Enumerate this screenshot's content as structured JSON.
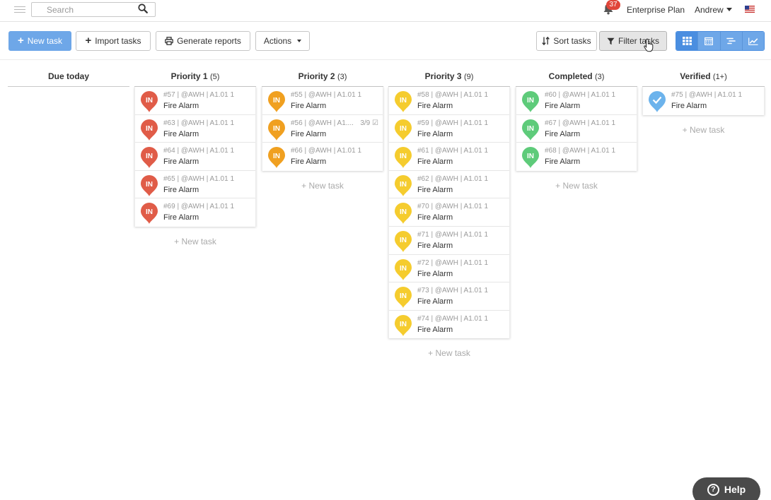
{
  "header": {
    "search_placeholder": "Search",
    "notification_count": "37",
    "plan": "Enterprise Plan",
    "user": "Andrew",
    "flag_icon": "us-flag-icon"
  },
  "toolbar": {
    "new_task": "New task",
    "import_tasks": "Import tasks",
    "generate_reports": "Generate reports",
    "actions": "Actions",
    "sort_tasks": "Sort tasks",
    "filter_tasks": "Filter tasks",
    "views": [
      "board-view-icon",
      "calendar-view-icon",
      "gantt-view-icon",
      "chart-view-icon"
    ]
  },
  "colors": {
    "primary": "#6ea7e8",
    "priority1": "#e05c48",
    "priority2": "#f0a020",
    "priority3": "#f5cc2e",
    "completed": "#5ecb7a",
    "verified": "#6cb3ec"
  },
  "board": {
    "new_task_label": "+ New task",
    "columns": [
      {
        "title": "Due today",
        "count": "",
        "status": "none",
        "cards": []
      },
      {
        "title": "Priority 1",
        "count": "(5)",
        "status": "priority1",
        "cards": [
          {
            "meta": "#57 | @AWH | A1.01 1",
            "title": "Fire Alarm",
            "pin": "IN"
          },
          {
            "meta": "#63 | @AWH | A1.01 1",
            "title": "Fire Alarm",
            "pin": "IN"
          },
          {
            "meta": "#64 | @AWH | A1.01 1",
            "title": "Fire Alarm",
            "pin": "IN"
          },
          {
            "meta": "#65 | @AWH | A1.01 1",
            "title": "Fire Alarm",
            "pin": "IN"
          },
          {
            "meta": "#69 | @AWH | A1.01 1",
            "title": "Fire Alarm",
            "pin": "IN"
          }
        ]
      },
      {
        "title": "Priority 2",
        "count": "(3)",
        "status": "priority2",
        "cards": [
          {
            "meta": "#55 | @AWH | A1.01 1",
            "title": "Fire Alarm",
            "pin": "IN"
          },
          {
            "meta": "#56 | @AWH | A1....",
            "title": "Fire Alarm",
            "pin": "IN",
            "checklist": "3/9"
          },
          {
            "meta": "#66 | @AWH | A1.01 1",
            "title": "Fire Alarm",
            "pin": "IN"
          }
        ]
      },
      {
        "title": "Priority 3",
        "count": "(9)",
        "status": "priority3",
        "cards": [
          {
            "meta": "#58 | @AWH | A1.01 1",
            "title": "Fire Alarm",
            "pin": "IN"
          },
          {
            "meta": "#59 | @AWH | A1.01 1",
            "title": "Fire Alarm",
            "pin": "IN"
          },
          {
            "meta": "#61 | @AWH | A1.01 1",
            "title": "Fire Alarm",
            "pin": "IN"
          },
          {
            "meta": "#62 | @AWH | A1.01 1",
            "title": "Fire Alarm",
            "pin": "IN"
          },
          {
            "meta": "#70 | @AWH | A1.01 1",
            "title": "Fire Alarm",
            "pin": "IN"
          },
          {
            "meta": "#71 | @AWH | A1.01 1",
            "title": "Fire Alarm",
            "pin": "IN"
          },
          {
            "meta": "#72 | @AWH | A1.01 1",
            "title": "Fire Alarm",
            "pin": "IN"
          },
          {
            "meta": "#73 | @AWH | A1.01 1",
            "title": "Fire Alarm",
            "pin": "IN"
          },
          {
            "meta": "#74 | @AWH | A1.01 1",
            "title": "Fire Alarm",
            "pin": "IN"
          }
        ]
      },
      {
        "title": "Completed",
        "count": "(3)",
        "status": "completed",
        "cards": [
          {
            "meta": "#60 | @AWH | A1.01 1",
            "title": "Fire Alarm",
            "pin": "IN"
          },
          {
            "meta": "#67 | @AWH | A1.01 1",
            "title": "Fire Alarm",
            "pin": "IN"
          },
          {
            "meta": "#68 | @AWH | A1.01 1",
            "title": "Fire Alarm",
            "pin": "IN"
          }
        ]
      },
      {
        "title": "Verified",
        "count": "(1+)",
        "status": "verified",
        "cards": [
          {
            "meta": "#75 | @AWH | A1.01 1",
            "title": "Fire Alarm",
            "pin": "check"
          }
        ]
      }
    ]
  },
  "help": {
    "label": "Help"
  }
}
